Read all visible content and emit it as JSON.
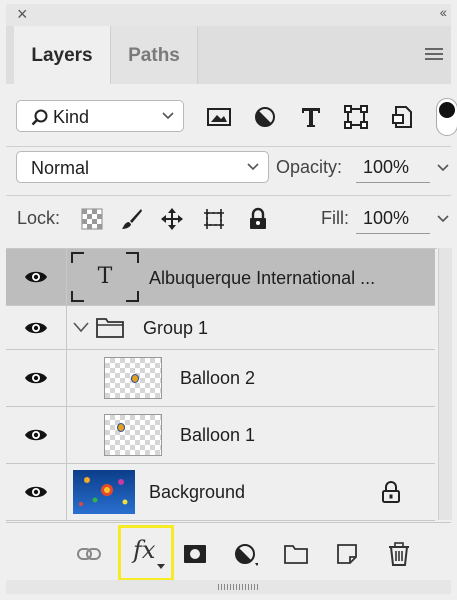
{
  "panel": {
    "tabs": [
      {
        "label": "Layers",
        "active": true
      },
      {
        "label": "Paths",
        "active": false
      }
    ],
    "icons": {
      "close": "close-icon",
      "collapse": "collapse-icon",
      "menu": "panel-menu-icon"
    }
  },
  "filter": {
    "kind_label": "Kind",
    "icons": [
      "image-filter-icon",
      "adjustment-filter-icon",
      "type-filter-icon",
      "shape-filter-icon",
      "smart-object-filter-icon"
    ]
  },
  "blend": {
    "mode": "Normal",
    "opacity_label": "Opacity:",
    "opacity_value": "100%"
  },
  "lock": {
    "label": "Lock:",
    "icons": [
      "lock-transparent-icon",
      "lock-image-icon",
      "lock-position-icon",
      "lock-artboard-icon",
      "lock-all-icon"
    ],
    "fill_label": "Fill:",
    "fill_value": "100%"
  },
  "layers": [
    {
      "name": "Albuquerque International ...",
      "type": "text",
      "selected": true,
      "visible": true
    },
    {
      "name": "Group 1",
      "type": "group",
      "selected": false,
      "visible": true,
      "expanded": true
    },
    {
      "name": "Balloon 2",
      "type": "pixel",
      "selected": false,
      "visible": true
    },
    {
      "name": "Balloon 1",
      "type": "pixel",
      "selected": false,
      "visible": true
    },
    {
      "name": "Background",
      "type": "background",
      "selected": false,
      "visible": true,
      "locked": true
    }
  ],
  "footer": {
    "icons": [
      "link-layers-icon",
      "fx-icon",
      "add-mask-icon",
      "adjustment-layer-icon",
      "new-group-icon",
      "new-layer-icon",
      "delete-layer-icon"
    ],
    "fx_label": "fx",
    "highlight_color": "#f5ec26"
  },
  "colors": {
    "panel_bg": "#efefef",
    "selected_row": "#bdbdbd",
    "highlight": "#f5ec26"
  }
}
